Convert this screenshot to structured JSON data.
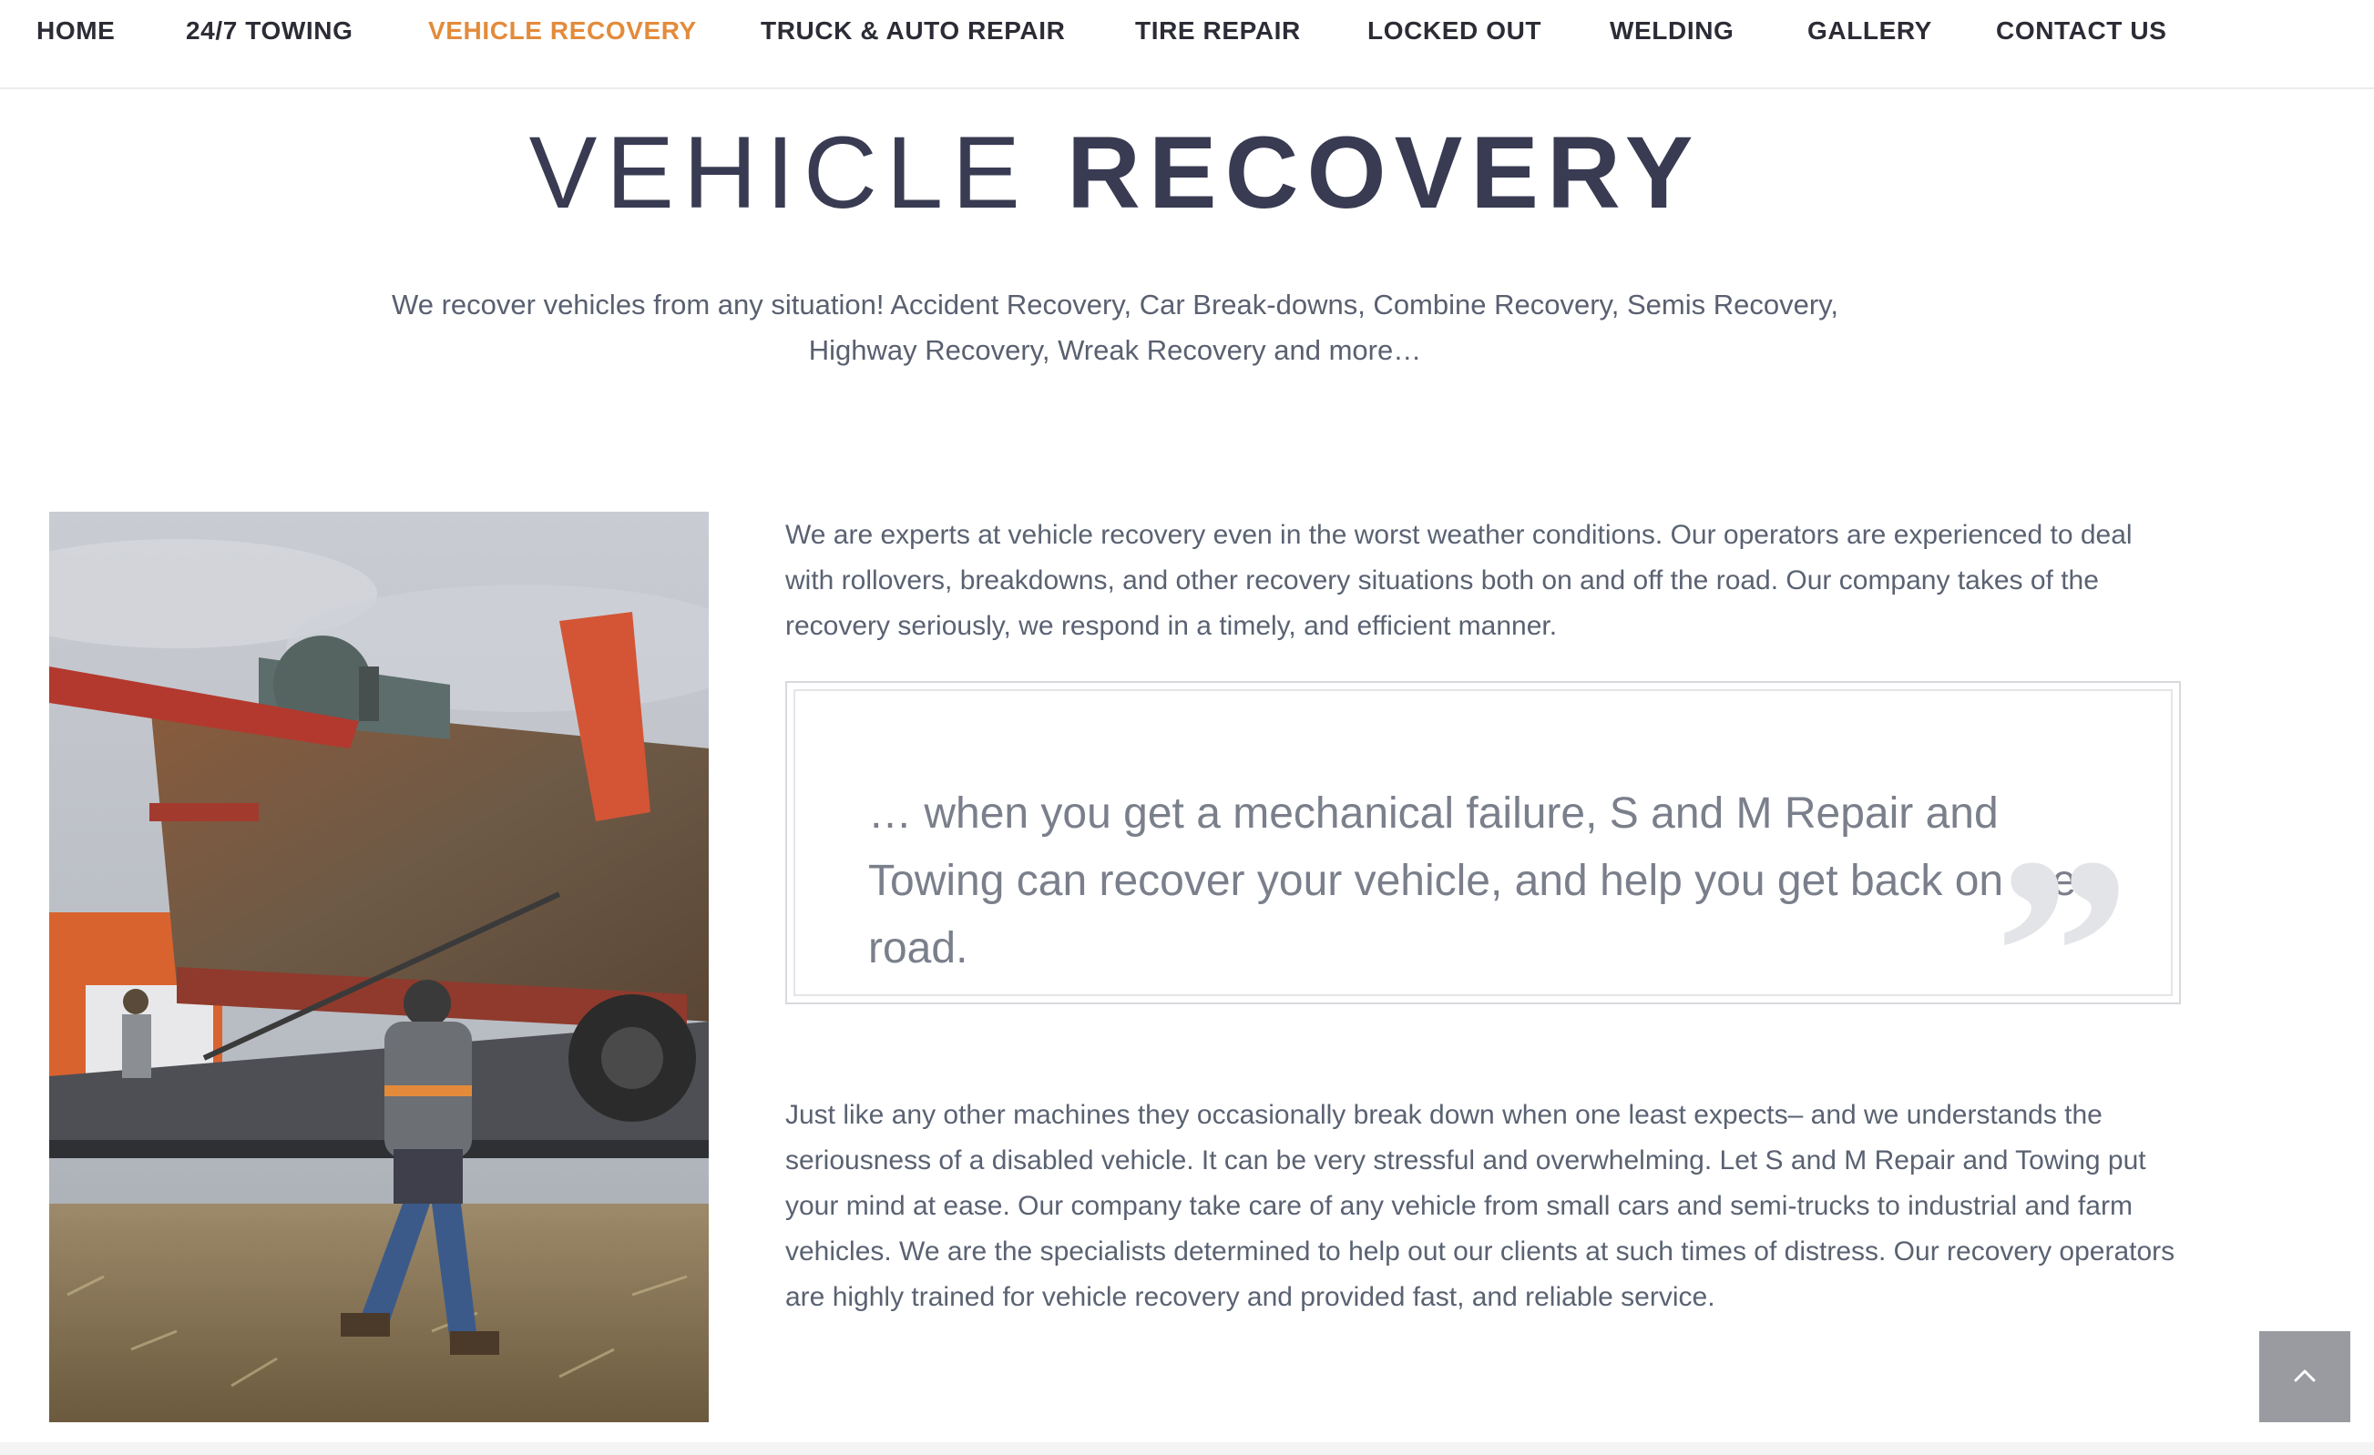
{
  "nav": {
    "items": [
      {
        "label": "HOME",
        "active": false
      },
      {
        "label": "24/7 TOWING",
        "active": false
      },
      {
        "label": "VEHICLE RECOVERY",
        "active": true
      },
      {
        "label": "TRUCK & AUTO REPAIR",
        "active": false
      },
      {
        "label": "TIRE REPAIR",
        "active": false
      },
      {
        "label": "LOCKED OUT",
        "active": false
      },
      {
        "label": "WELDING",
        "active": false
      },
      {
        "label": "GALLERY",
        "active": false
      },
      {
        "label": "CONTACT US",
        "active": false
      }
    ],
    "active_color": "#e38b3b",
    "text_color": "#2c2c36"
  },
  "page": {
    "title_light": "VEHICLE",
    "title_bold": "RECOVERY",
    "intro": "We recover vehicles from any situation! Accident Recovery, Car Break-downs, Combine Recovery, Semis Recovery, Highway Recovery, Wreak Recovery and more…"
  },
  "content": {
    "photo": {
      "icon": "photo-combine-recovery",
      "description_visible": false
    },
    "paragraph_1": "We are experts at vehicle recovery even in the worst weather conditions. Our operators are experienced to deal with rollovers, breakdowns, and other recovery situations both on and off the road. Our company takes of the recovery seriously, we respond in a timely, and efficient manner.",
    "quote": "… when you get a mechanical failure, S and M Repair and Towing can recover your vehicle, and help you get back on the road.",
    "quote_mark": "”",
    "paragraph_2": "Just like any other machines they occasionally break down when one least expects– and we understands the seriousness of a disabled vehicle. It can be very stressful and overwhelming. Let S and M Repair and Towing put your mind at ease. Our company take care of any vehicle from small cars and semi-trucks to industrial and farm vehicles.  We are the specialists determined to help out our clients at such times of distress. Our recovery operators are highly trained for vehicle recovery and  provided fast, and reliable service."
  },
  "scroll_top": {
    "icon": "chevron-up-icon",
    "color": "#9a9ba0"
  }
}
